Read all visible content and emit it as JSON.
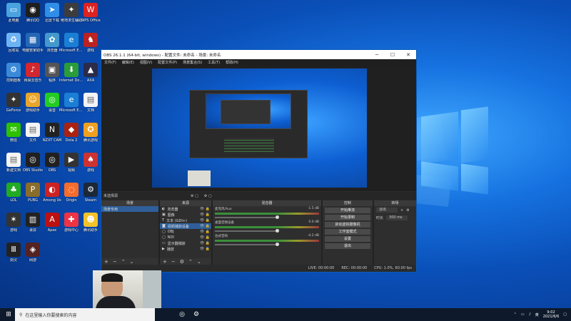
{
  "desktop_icons": [
    {
      "label": "此电脑",
      "icon": "computer-icon",
      "color": "#4aa3df",
      "glyph": "▭"
    },
    {
      "label": "腾讯QQ",
      "icon": "qq-icon",
      "color": "#1e1e1e",
      "glyph": "◉"
    },
    {
      "label": "迅雷下载",
      "icon": "thunder-icon",
      "color": "#2f8ee8",
      "glyph": "➤"
    },
    {
      "label": "绝地求生辅助",
      "icon": "game-icon",
      "color": "#3c3c3c",
      "glyph": "✦"
    },
    {
      "label": "WPS Office",
      "icon": "wps-icon",
      "color": "#d22",
      "glyph": "W"
    },
    {
      "label": "回收站",
      "icon": "recycle-bin-icon",
      "color": "#6db3f2",
      "glyph": "♻"
    },
    {
      "label": "电脑管家助手",
      "icon": "app-icon",
      "color": "#2667b5",
      "glyph": "▦"
    },
    {
      "label": "浏览器",
      "icon": "app-icon",
      "color": "#49c",
      "glyph": "✿"
    },
    {
      "label": "Microsoft Edge",
      "icon": "edge-icon",
      "color": "#1a7fd4",
      "glyph": "e"
    },
    {
      "label": "游戏",
      "icon": "game-icon",
      "color": "#b22",
      "glyph": "♞"
    },
    {
      "label": "控制面板",
      "icon": "control-panel-icon",
      "color": "#3a8ad8",
      "glyph": "⚙"
    },
    {
      "label": "网易云音乐",
      "icon": "music-icon",
      "color": "#d3262e",
      "glyph": "♪"
    },
    {
      "label": "程序",
      "icon": "app-icon",
      "color": "#555",
      "glyph": "▣"
    },
    {
      "label": "Internet Download",
      "icon": "download-icon",
      "color": "#2a9d3a",
      "glyph": "⬇"
    },
    {
      "label": "AXA",
      "icon": "app-icon",
      "color": "#2b2b4a",
      "glyph": "▲"
    },
    {
      "label": "GeForce",
      "icon": "app-icon",
      "color": "#333",
      "glyph": "✦"
    },
    {
      "label": "游戏助手",
      "icon": "game-icon",
      "color": "#e8a52a",
      "glyph": "☺"
    },
    {
      "label": "语音",
      "icon": "app-icon",
      "color": "#2c2",
      "glyph": "◎"
    },
    {
      "label": "Microsoft Edge",
      "icon": "edge-icon",
      "color": "#1a7fd4",
      "glyph": "e"
    },
    {
      "label": "文档",
      "icon": "document-icon",
      "color": "#f4f4f4",
      "glyph": "▤"
    },
    {
      "label": "微信",
      "icon": "wechat-icon",
      "color": "#2dc100",
      "glyph": "✉"
    },
    {
      "label": "文件",
      "icon": "document-icon",
      "color": "#f4f4f4",
      "glyph": "▤"
    },
    {
      "label": "NZXT CAM",
      "icon": "app-icon",
      "color": "#222",
      "glyph": "N"
    },
    {
      "label": "Dota 2",
      "icon": "game-icon",
      "color": "#a21",
      "glyph": "◆"
    },
    {
      "label": "腾讯游戏",
      "icon": "game-icon",
      "color": "#f0a020",
      "glyph": "✪"
    },
    {
      "label": "新建文档",
      "icon": "document-icon",
      "color": "#f4f4f4",
      "glyph": "▤"
    },
    {
      "label": "OBS Studio",
      "icon": "obs-icon",
      "color": "#202020",
      "glyph": "◎"
    },
    {
      "label": "OBS",
      "icon": "obs-icon",
      "color": "#202020",
      "glyph": "◎"
    },
    {
      "label": "视频",
      "icon": "app-icon",
      "color": "#333",
      "glyph": "▶"
    },
    {
      "label": "游戏",
      "icon": "game-icon",
      "color": "#c33",
      "glyph": "♠"
    },
    {
      "label": "LOL",
      "icon": "game-icon",
      "color": "#2a2",
      "glyph": "♣"
    },
    {
      "label": "PUBG",
      "icon": "game-icon",
      "color": "#8a6d2a",
      "glyph": "P"
    },
    {
      "label": "Among Us",
      "icon": "game-icon",
      "color": "#c22",
      "glyph": "◐"
    },
    {
      "label": "Origin",
      "icon": "origin-icon",
      "color": "#f56c2d",
      "glyph": "◌"
    },
    {
      "label": "Steam",
      "icon": "steam-icon",
      "color": "#1b2838",
      "glyph": "⚙"
    },
    {
      "label": "游戏",
      "icon": "game-icon",
      "color": "#333",
      "glyph": "✶"
    },
    {
      "label": "录屏",
      "icon": "app-icon",
      "color": "#222",
      "glyph": "▥"
    },
    {
      "label": "Apex",
      "icon": "game-icon",
      "color": "#b11",
      "glyph": "A"
    },
    {
      "label": "游戏中心",
      "icon": "game-icon",
      "color": "#e34",
      "glyph": "✚"
    },
    {
      "label": "腾讯助手",
      "icon": "app-icon",
      "color": "#f3c22a",
      "glyph": "☻"
    },
    {
      "label": "剑灵",
      "icon": "game-icon",
      "color": "#222",
      "glyph": "Ⅲ"
    },
    {
      "label": "网游",
      "icon": "game-icon",
      "color": "#522",
      "glyph": "◈"
    }
  ],
  "obs": {
    "title": "OBS 26.1.1 (64-bit, windows) - 配置文件: 未命名 - 场景: 未命名",
    "menu": [
      "文件(F)",
      "编辑(E)",
      "视图(V)",
      "配置文件(P)",
      "场景集合(S)",
      "工具(T)",
      "帮助(H)"
    ],
    "scene_strip": "未选择源",
    "docks": {
      "scenes": "场景",
      "sources": "来源",
      "mixer": "混音器",
      "transitions": "转场",
      "controls": "控制"
    },
    "scenes": [
      "场景专用"
    ],
    "sources": [
      {
        "name": "浏览器",
        "icon": "browser-icon"
      },
      {
        "name": "图像",
        "icon": "image-icon"
      },
      {
        "name": "文本 (GDI+)",
        "icon": "text-icon"
      },
      {
        "name": "视频捕获设备",
        "icon": "camera-icon"
      },
      {
        "name": "OBJ",
        "icon": "object-icon"
      },
      {
        "name": "NDI",
        "icon": "object-icon"
      },
      {
        "name": "显示器捕获",
        "icon": "monitor-icon"
      },
      {
        "name": "播放",
        "icon": "media-icon"
      }
    ],
    "mixer": [
      {
        "name": "麦克风/Aux",
        "db": "-1.5 dB"
      },
      {
        "name": "桌面音频设备",
        "db": "0.0 dB"
      },
      {
        "name": "台式音响",
        "db": "-4.2 dB"
      }
    ],
    "transitions": {
      "value": "淡出",
      "duration_label": "时长",
      "duration": "300 ms"
    },
    "controls": [
      "开始推流",
      "开始录制",
      "启动虚拟摄像机",
      "工作室模式",
      "设置",
      "退出"
    ],
    "status": {
      "live": "LIVE: 00:00:00",
      "rec": "REC: 00:00:00",
      "cpu": "CPU: 1.0%, 60.00 fps"
    }
  },
  "taskbar": {
    "search_placeholder": "在这里输入你要搜索的内容",
    "clock_time": "9:02",
    "clock_date": "2021/6/6"
  }
}
